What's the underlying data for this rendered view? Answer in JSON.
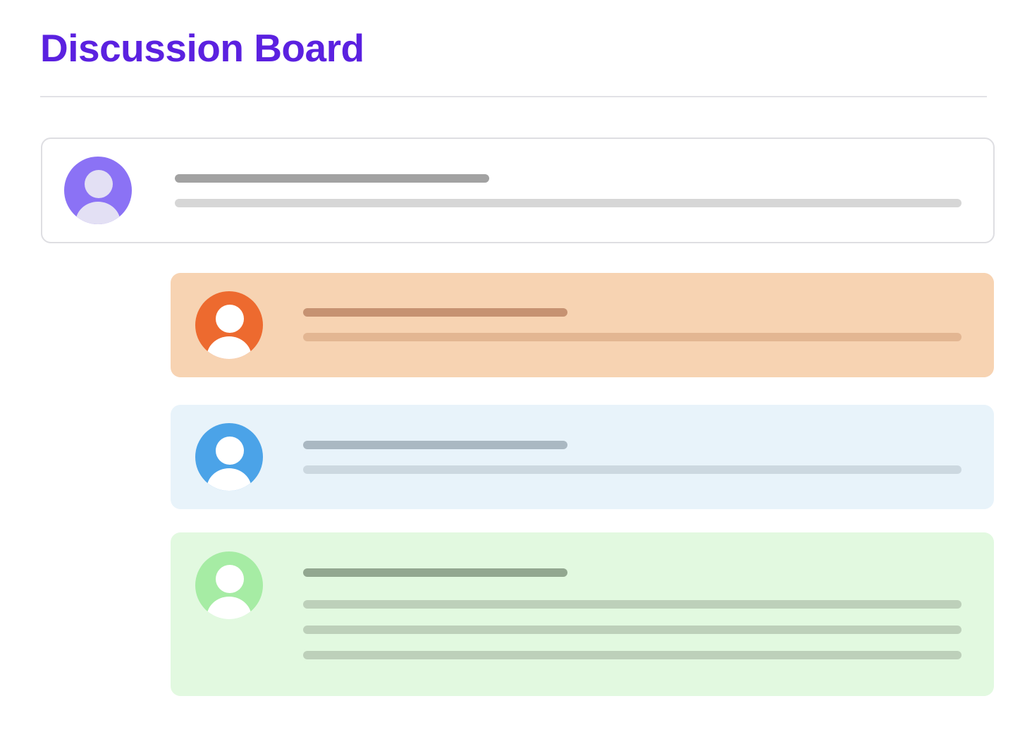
{
  "header": {
    "title": "Discussion Board",
    "title_color": "#5b21e0"
  },
  "posts": [
    {
      "kind": "root",
      "card_color": "#ffffff",
      "avatar": {
        "icon": "user-avatar-icon",
        "bg": "#8b72f5",
        "figure": "#e3e0f4"
      },
      "title_bar_color": "#a2a2a2",
      "text_bar_color": "#d6d6d6",
      "text_lines": 1
    },
    {
      "kind": "reply",
      "card_color": "#f7d3b2",
      "avatar": {
        "icon": "user-avatar-icon",
        "bg": "#ed6a2f",
        "figure": "#ffffff"
      },
      "title_bar_color": "#c69272",
      "text_bar_color": "#e3b692",
      "text_lines": 1
    },
    {
      "kind": "reply",
      "card_color": "#e8f3fa",
      "avatar": {
        "icon": "user-avatar-icon",
        "bg": "#4ba3e8",
        "figure": "#ffffff"
      },
      "title_bar_color": "#aab8c2",
      "text_bar_color": "#ccd8e0",
      "text_lines": 1
    },
    {
      "kind": "reply",
      "card_color": "#e2f9e0",
      "avatar": {
        "icon": "user-avatar-icon",
        "bg": "#a6eca4",
        "figure": "#ffffff"
      },
      "title_bar_color": "#92a790",
      "text_bar_color": "#bdd0ba",
      "text_lines": 3
    }
  ]
}
